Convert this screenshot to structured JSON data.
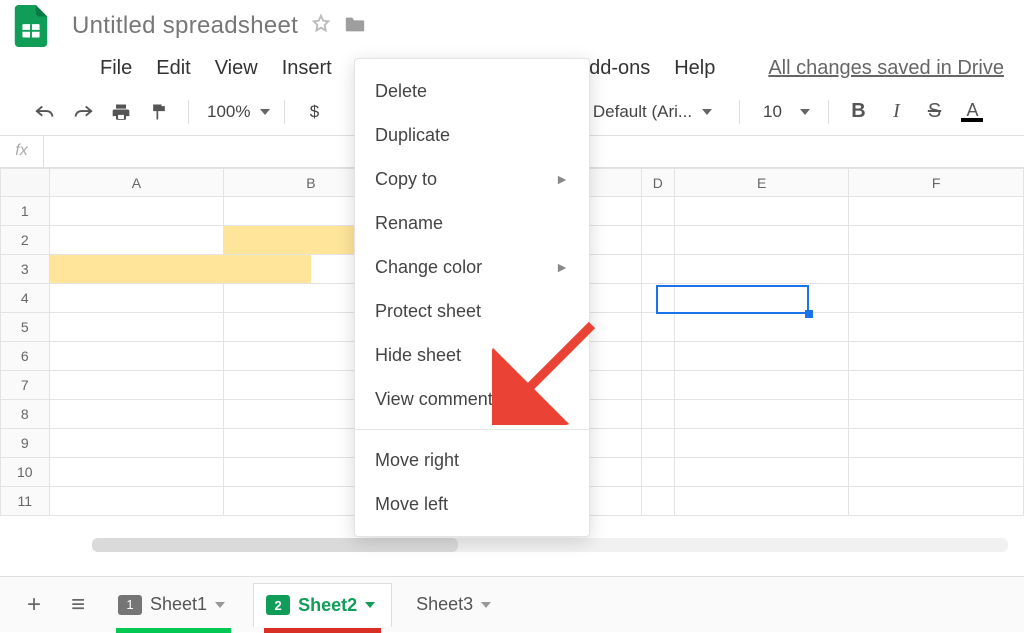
{
  "app": {
    "title": "Untitled spreadsheet"
  },
  "menus": {
    "file": "File",
    "edit": "Edit",
    "view": "View",
    "insert": "Insert",
    "addons": "Add-ons",
    "help": "Help",
    "save_msg": "All changes saved in Drive"
  },
  "toolbar": {
    "zoom": "100%",
    "currency": "$",
    "font": "Default (Ari...",
    "fontsize": "10",
    "bold": "B",
    "italic": "I",
    "strike": "S",
    "textcolor": "A"
  },
  "formula": {
    "label": "fx",
    "value": ""
  },
  "columns": [
    "A",
    "B",
    "D",
    "E",
    "F"
  ],
  "rows": [
    "1",
    "2",
    "3",
    "4",
    "5",
    "6",
    "7",
    "8",
    "9",
    "10",
    "11"
  ],
  "grid": {
    "highlighted": [
      {
        "r": 3,
        "c": "A"
      },
      {
        "r": 2,
        "c": "B"
      }
    ],
    "half_highlight": {
      "r": 3,
      "c": "B"
    },
    "active": "E4"
  },
  "context_menu": {
    "items": [
      "Delete",
      "Duplicate",
      "Copy to",
      "Rename",
      "Change color",
      "Protect sheet",
      "Hide sheet",
      "View comments",
      "Move right",
      "Move left"
    ],
    "submenu_indices": [
      2,
      4
    ],
    "separator_after_index": 7
  },
  "tabs": {
    "add": "+",
    "all": "≡",
    "sheets": [
      {
        "name": "Sheet1",
        "badge": "1",
        "badge_color": "#757575",
        "tail_color": "#757575",
        "underline": "#00c853",
        "active": false
      },
      {
        "name": "Sheet2",
        "badge": "2",
        "badge_color": "#0f9d58",
        "tail_color": "#0f9d58",
        "underline": "#d93025",
        "active": true
      },
      {
        "name": "Sheet3",
        "badge": "",
        "badge_color": "",
        "tail_color": "",
        "underline": "",
        "active": false
      }
    ]
  },
  "colors": {
    "brand": "#0f9d58",
    "accent": "#1a73e8",
    "arrow": "#ea4335"
  }
}
